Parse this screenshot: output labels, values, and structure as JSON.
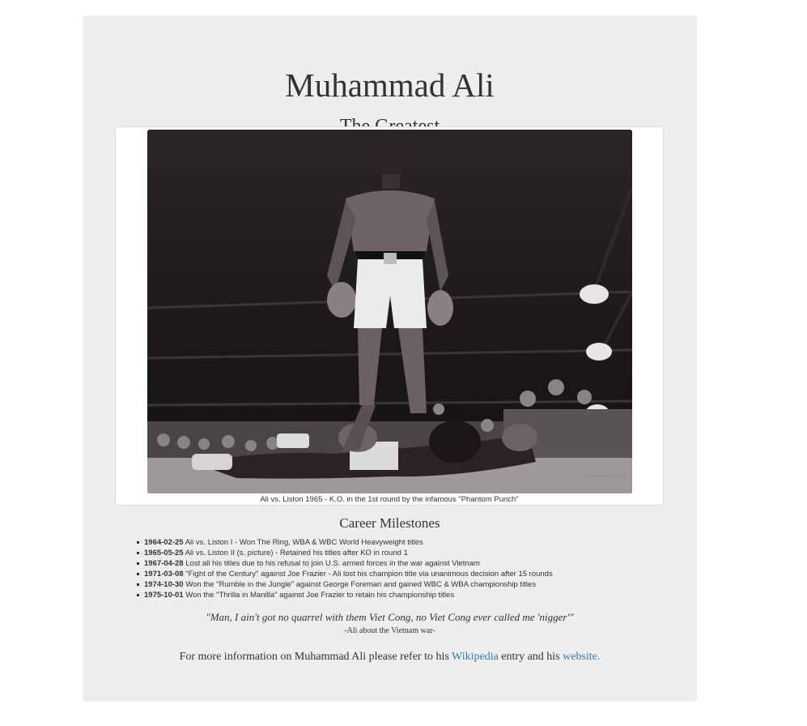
{
  "page": {
    "title": "Muhammad Ali",
    "subtitle": "The Greatest"
  },
  "image": {
    "caption": "Ali vs. Liston 1965 - K.O. in the 1st round by the infamous \"Phantom Punch\"",
    "alt": "Ali standing over Liston knocked down in the ring",
    "watermark": "allposters.com"
  },
  "milestones": {
    "title": "Career Milestones",
    "items": [
      {
        "date": "1964-02-25",
        "text": " Ali vs. Liston I - Won The Ring, WBA & WBC World Heavyweight titles"
      },
      {
        "date": "1965-05-25",
        "text": " Ali vs. Liston II (s. picture) - Retained his titles after KO in round 1"
      },
      {
        "date": "1967-04-28",
        "text": " Lost all his titles due to his refusal to join U.S. armed forces in the war against Vietnam"
      },
      {
        "date": "1971-03-08",
        "text": " \"Fight of the Century\" against Joe Frazier - Ali lost his champion title via unanimous decision after 15 rounds"
      },
      {
        "date": "1974-10-30",
        "text": " Won the \"Rumble in the Jungle\" against George Foreman and gained WBC & WBA championship titles"
      },
      {
        "date": "1975-10-01",
        "text": " Won the \"Thrilla in Manilla\" against Joe Frazier to retain his championship titles"
      }
    ]
  },
  "quote": {
    "text": "\"Man, I ain't got no quarrel with them Viet Cong, no Viet Cong ever called me 'nigger'\"",
    "author": "-Ali about the Vietnam war-"
  },
  "more_info": {
    "prefix": "For more information on Muhammad Ali please refer to his ",
    "link1": "Wikipedia",
    "middle": " entry and his ",
    "link2": "website."
  },
  "colors": {
    "well_bg": "#eeeeee",
    "link": "#337ab7",
    "text": "#333333"
  }
}
